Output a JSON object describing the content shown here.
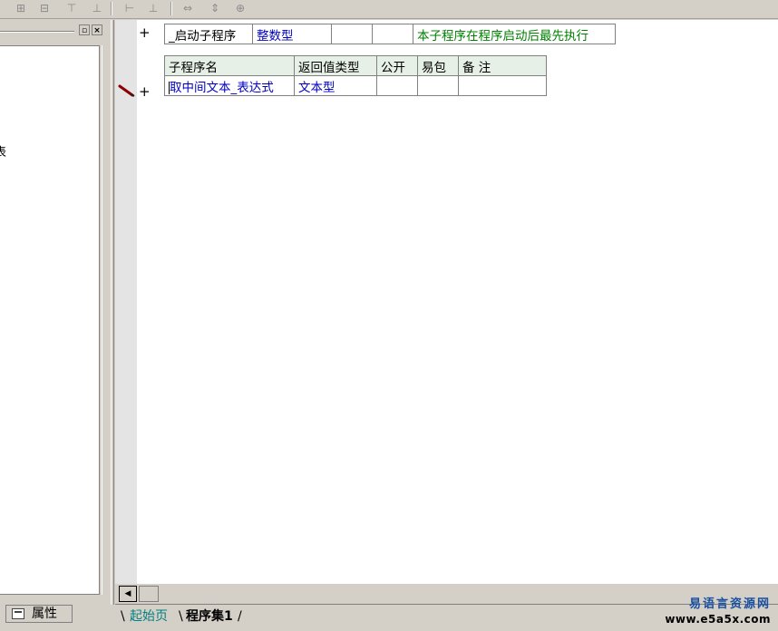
{
  "left_panel": {
    "partial_text": "表",
    "properties_tab_label": "属性"
  },
  "editor": {
    "startup_row": {
      "name": "_启动子程序",
      "return_type": "整数型",
      "public": "",
      "easy_package": "",
      "note": "本子程序在程序启动后最先执行"
    },
    "subroutine_table": {
      "headers": [
        "子程序名",
        "返回值类型",
        "公开",
        "易包",
        "备 注"
      ],
      "row": {
        "name": "取中间文本_表达式",
        "return_type": "文本型",
        "public": "",
        "easy_package": "",
        "note": ""
      }
    },
    "plus_symbol": "+"
  },
  "tabs": {
    "start_page": "起始页",
    "program_set": "程序集1"
  },
  "watermark": {
    "line1": "易语言资源网",
    "line2": "www.e5a5x.com"
  },
  "colors": {
    "keyword_blue": "#0000c0",
    "comment_green": "#008000",
    "header_bg": "#e6f0e6",
    "chrome": "#d4d0c8"
  }
}
